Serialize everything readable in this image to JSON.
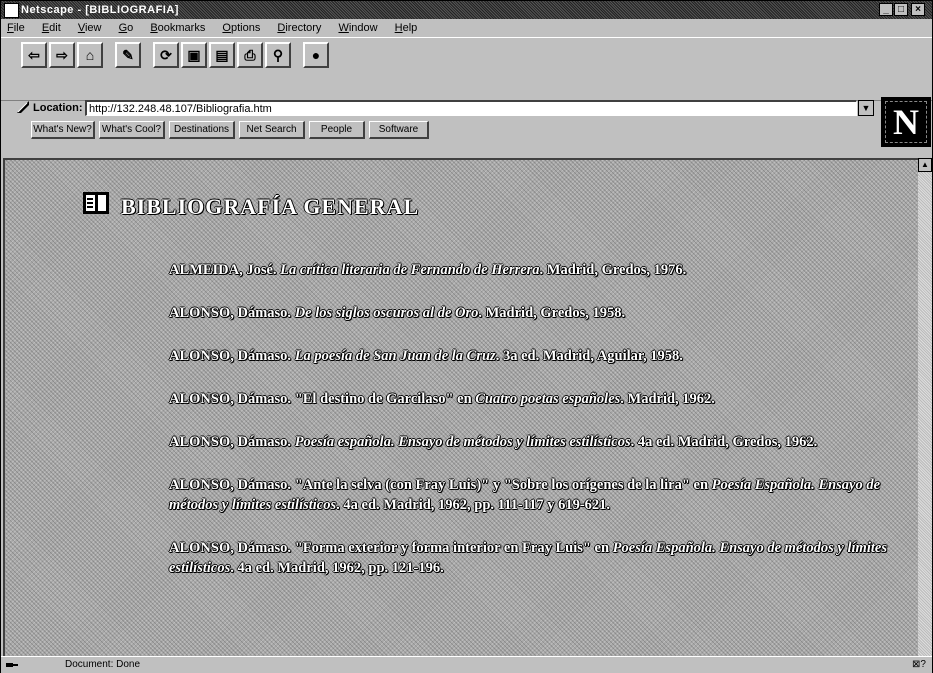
{
  "window": {
    "title": "Netscape - [BIBLIOGRAFIA]",
    "controls": [
      "_",
      "□",
      "×"
    ]
  },
  "menu": [
    "File",
    "Edit",
    "View",
    "Go",
    "Bookmarks",
    "Options",
    "Directory",
    "Window",
    "Help"
  ],
  "toolbar": {
    "buttons": [
      {
        "icon": "back-icon",
        "glyph": "⇦"
      },
      {
        "icon": "forward-icon",
        "glyph": "⇨"
      },
      {
        "icon": "home-icon",
        "glyph": "⌂"
      },
      {
        "icon": "edit-icon",
        "glyph": "✎"
      },
      {
        "icon": "reload-icon",
        "glyph": "⟳"
      },
      {
        "icon": "images-icon",
        "glyph": "▣"
      },
      {
        "icon": "open-icon",
        "glyph": "▤"
      },
      {
        "icon": "print-icon",
        "glyph": "⎙"
      },
      {
        "icon": "find-icon",
        "glyph": "⚲"
      },
      {
        "icon": "stop-icon",
        "glyph": "●"
      }
    ]
  },
  "location": {
    "label": "Location:",
    "value": "http://132.248.48.107/Bibliografia.htm"
  },
  "directory_buttons": [
    "What's New?",
    "What's Cool?",
    "Destinations",
    "Net Search",
    "People",
    "Software"
  ],
  "logo": "N",
  "page": {
    "heading": "BIBLIOGRAFÍA GENERAL",
    "entries": [
      {
        "author": "ALMEIDA, José.",
        "title": "La crítica literaria de Fernando de Herrera",
        "rest": ". Madrid, Gredos, 1976."
      },
      {
        "author": "ALONSO, Dámaso.",
        "title": "De los siglos oscuros al de Oro",
        "rest": ". Madrid, Gredos, 1958."
      },
      {
        "author": "ALONSO, Dámaso.",
        "title": "La poesía de San Juan de la Cruz",
        "rest": ". 3a ed. Madrid, Aguilar, 1958."
      },
      {
        "author": "ALONSO, Dámaso.",
        "pre": " \"El destino de Garcilaso\" en ",
        "title": "Cuatro poetas españoles",
        "rest": ". Madrid, 1962."
      },
      {
        "author": "ALONSO, Dámaso.",
        "title": "Poesía española. Ensayo de métodos y límites estilísticos",
        "rest": ". 4a ed. Madrid, Gredos, 1962."
      },
      {
        "author": "ALONSO, Dámaso.",
        "pre": " \"Ante la selva (con Fray Luis)\" y \"Sobre los orígenes de la lira\" en ",
        "title": "Poesía Española. Ensayo de métodos y límites estilísticos",
        "rest": ". 4a ed. Madrid, 1962, pp. 111-117 y 619-621."
      },
      {
        "author": "ALONSO, Dámaso.",
        "pre": " \"Forma exterior y forma interior en Fray Luis\" en ",
        "title": "Poesía Española. Ensayo de métodos y límites estilísticos",
        "rest": ". 4a ed. Madrid, 1962, pp. 121-196."
      }
    ]
  },
  "status": {
    "text": "Document: Done",
    "right": "⊠?"
  }
}
